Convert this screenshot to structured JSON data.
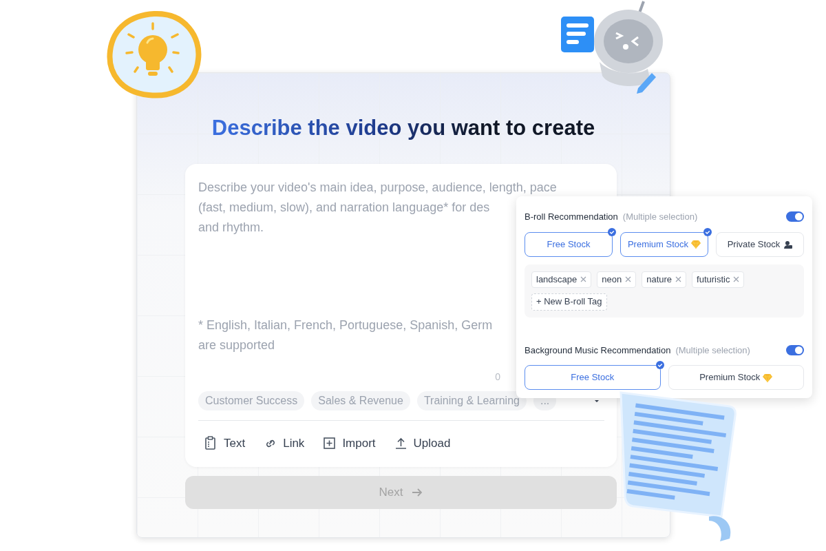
{
  "title": "Describe the video you want to create",
  "prompt": {
    "placeholder_lines": [
      "Describe your video's main idea, purpose, audience, length, pace",
      "(fast, medium, slow), and narration language* for des",
      "and rhythm."
    ],
    "note_lines": [
      "* English, Italian, French, Portuguese, Spanish, Germ",
      "are supported"
    ],
    "counter": "0"
  },
  "topics": [
    "Customer Success",
    "Sales & Revenue",
    "Training & Learning",
    "..."
  ],
  "tools": [
    {
      "kind": "text",
      "label": "Text"
    },
    {
      "kind": "link",
      "label": "Link"
    },
    {
      "kind": "import",
      "label": "Import"
    },
    {
      "kind": "upload",
      "label": "Upload"
    }
  ],
  "next_button": {
    "label": "Next",
    "disabled": true
  },
  "popup": {
    "sections": [
      {
        "title": "B-roll Recommendation",
        "hint": "(Multiple selection)",
        "on": true,
        "options": [
          {
            "label": "Free Stock",
            "kind": "plain",
            "selected": true
          },
          {
            "label": "Premium Stock",
            "kind": "premium",
            "selected": true
          },
          {
            "label": "Private Stock",
            "kind": "private",
            "selected": false
          }
        ],
        "tags": [
          "landscape",
          "neon",
          "nature",
          "futuristic"
        ],
        "new_tag": "+ New B-roll Tag"
      },
      {
        "title": "Background Music Recommendation",
        "hint": "(Multiple selection)",
        "on": true,
        "options": [
          {
            "label": "Free Stock",
            "kind": "plain",
            "selected": true
          },
          {
            "label": "Premium Stock",
            "kind": "premium",
            "selected": false
          }
        ]
      }
    ]
  }
}
